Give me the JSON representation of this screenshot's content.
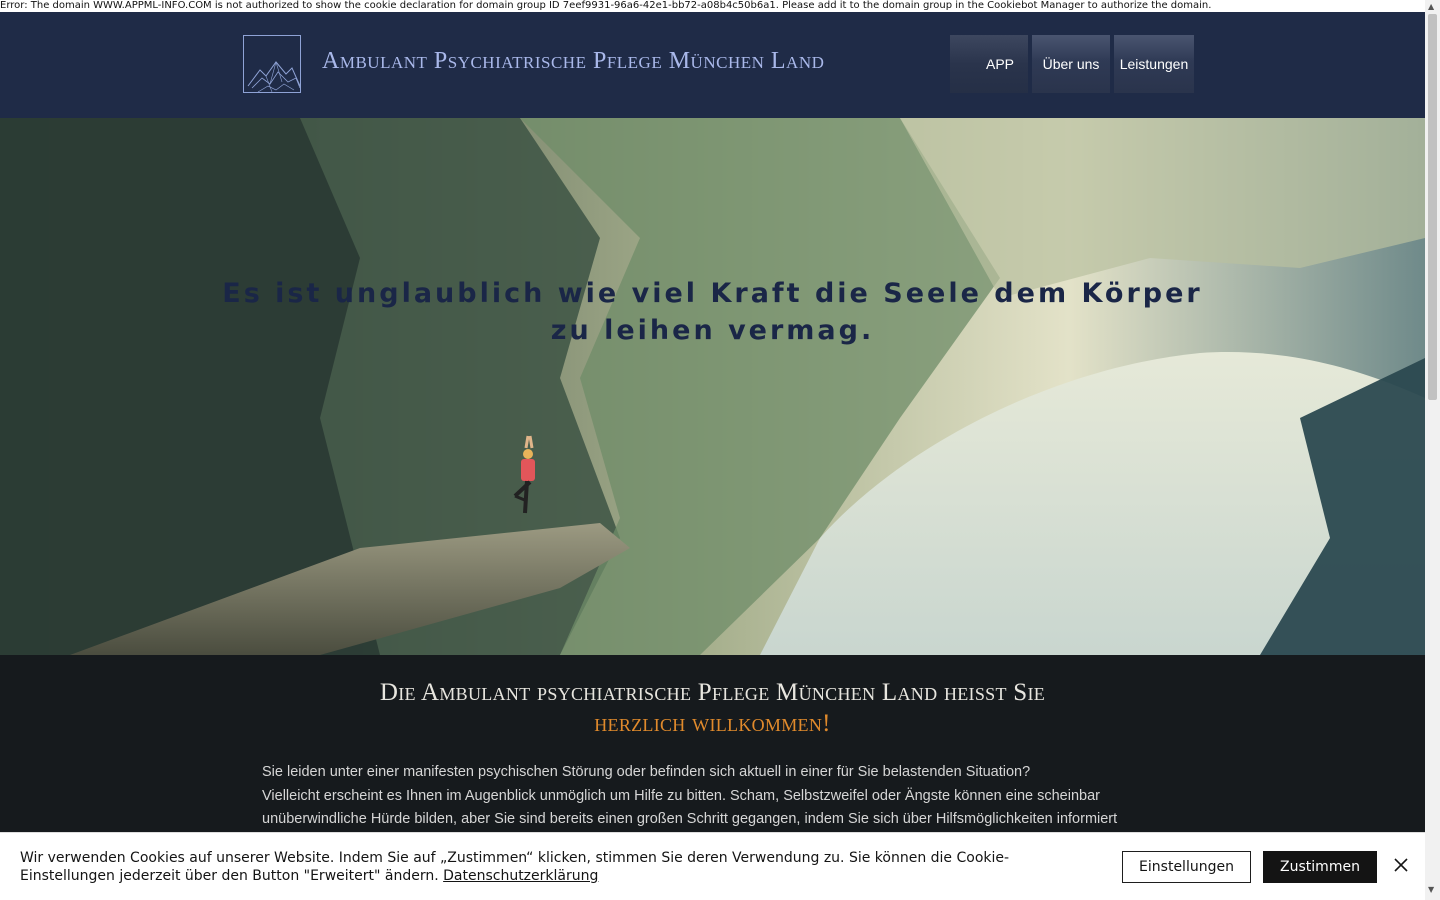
{
  "error_bar": {
    "text": "Error: The domain WWW.APPML-INFO.COM is not authorized to show the cookie declaration for domain group ID 7eef9931-96a6-42e1-bb72-a08b4c50b6a1. Please add it to the domain group in the Cookiebot Manager to authorize the domain."
  },
  "header": {
    "logo_icon": "mountain-logo-icon",
    "site_title": "Ambulant Psychiatrische Pflege München Land",
    "nav": [
      {
        "label": "APP"
      },
      {
        "label": "Über uns"
      },
      {
        "label": "Leistungen"
      }
    ]
  },
  "hero": {
    "quote": "Es ist unglaublich wie viel Kraft die Seele dem Körper zu leihen vermag."
  },
  "welcome": {
    "title_line1": "Die Ambulant psychiatrische Pflege München Land heisst Sie",
    "title_line2": "herzlich willkommen!",
    "paragraph_line1": "Sie leiden unter einer manifesten psychischen Störung oder befinden sich aktuell in einer für Sie belastenden Situation?",
    "paragraph_line2": "Vielleicht erscheint es Ihnen im Augenblick unmöglich um Hilfe zu bitten. Scham, Selbstzweifel oder Ängste können eine scheinbar",
    "paragraph_line3": "unüberwindliche Hürde bilden, aber Sie sind bereits einen großen Schritt gegangen, indem Sie sich über Hilfsmöglichkeiten informiert",
    "accent_color": "#e08a2c"
  },
  "cookie": {
    "text": "Wir verwenden Cookies auf unserer Website. Indem Sie auf „Zustimmen“ klicken, stimmen Sie deren Verwendung zu. Sie können die Cookie-Einstellungen jederzeit über den Button \"Erweitert\" ändern.",
    "link_label": "Datenschutzerklärung",
    "settings_label": "Einstellungen",
    "accept_label": "Zustimmen",
    "close_icon": "close-icon"
  },
  "colors": {
    "header_bg": "#1f2b47",
    "title_color": "#a9b8ea",
    "quote_color": "#1a2647"
  }
}
